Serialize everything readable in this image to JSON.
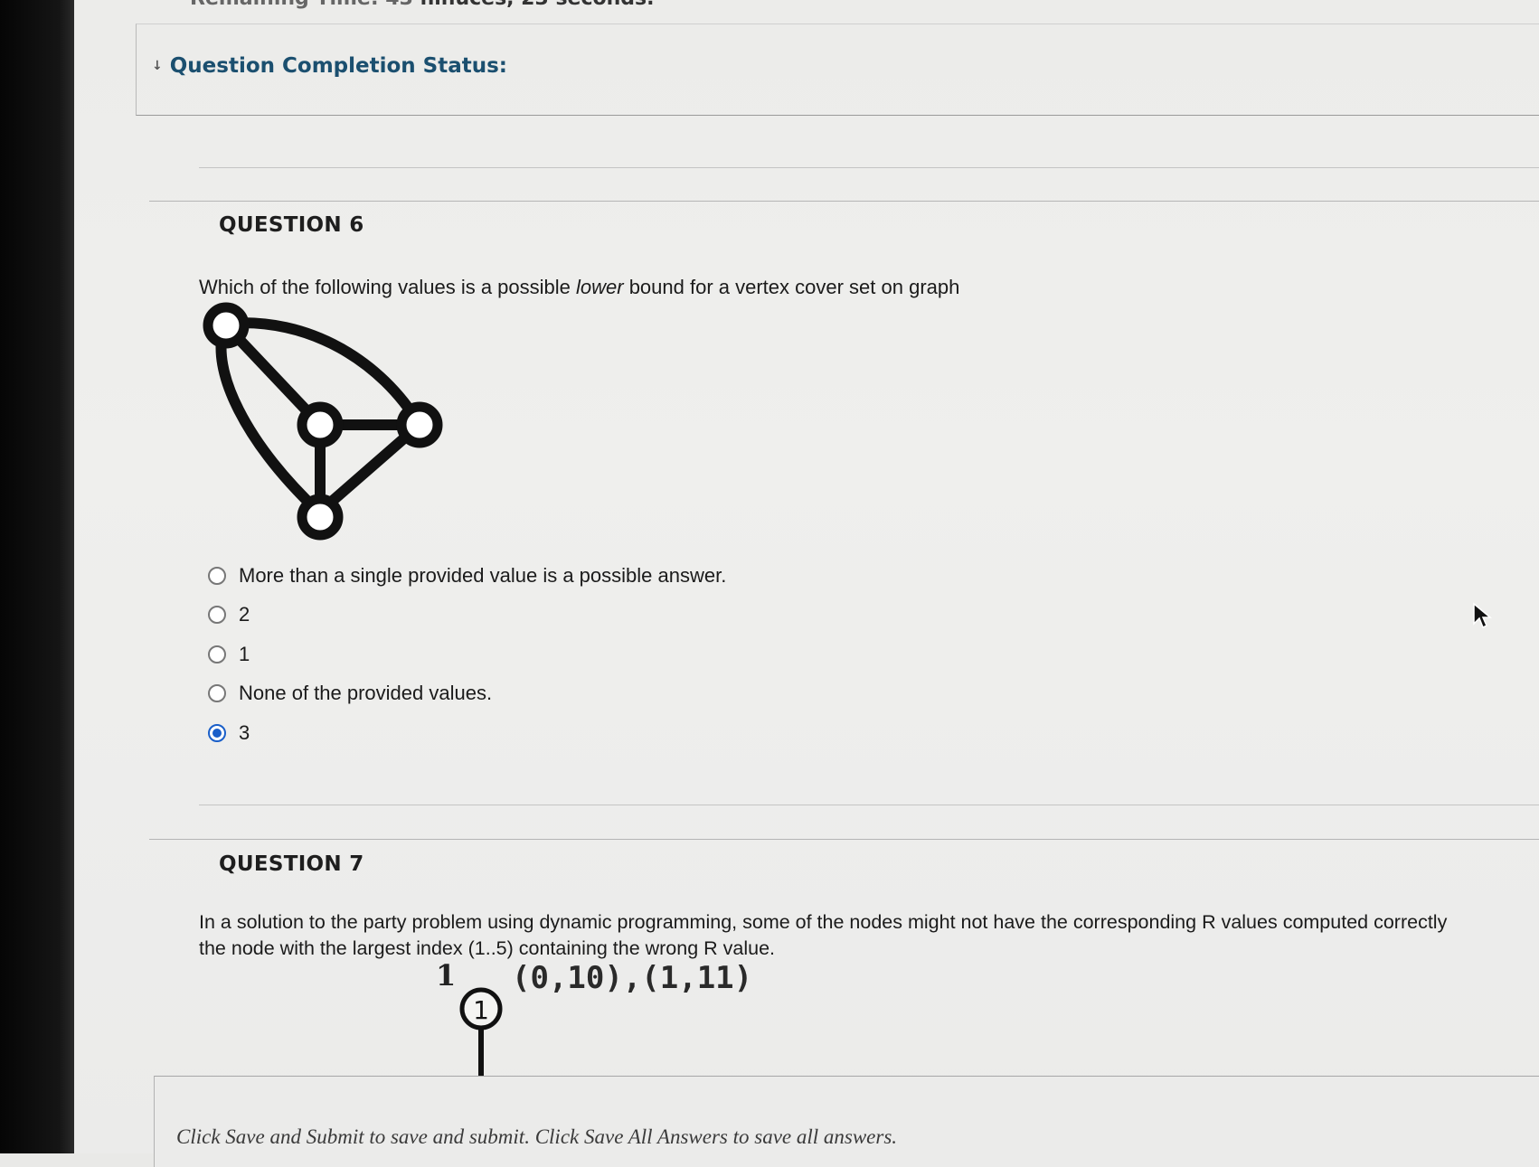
{
  "timer": {
    "partial": "ninuces, 23 seconds."
  },
  "completion_status": {
    "label": "Question Completion Status:",
    "icon": "chevron-down-icon"
  },
  "question6": {
    "heading": "QUESTION 6",
    "prompt_before": "Which of the following values is a possible ",
    "prompt_emphasis": "lower",
    "prompt_after": " bound for a vertex cover set on graph",
    "options": [
      {
        "label": "More than a single provided value is a possible answer.",
        "selected": false
      },
      {
        "label": "2",
        "selected": false
      },
      {
        "label": "1",
        "selected": false
      },
      {
        "label": "None of the provided values.",
        "selected": false
      },
      {
        "label": "3",
        "selected": true
      }
    ]
  },
  "question7": {
    "heading": "QUESTION 7",
    "prompt_line1": "In a solution to the party problem using dynamic programming, some of the nodes might not have the corresponding R values computed correctly",
    "prompt_line2": "the node with the largest index (1..5) containing the wrong R value.",
    "tree_node_label": "1",
    "tree_node_id": "1",
    "tree_node_pairs": "(0,10),(1,11)"
  },
  "footer": {
    "instructions": "Click Save and Submit to save and submit. Click Save All Answers to save all answers."
  },
  "colors": {
    "accent": "#1a5fc9",
    "status_link": "#1b4f6f"
  }
}
